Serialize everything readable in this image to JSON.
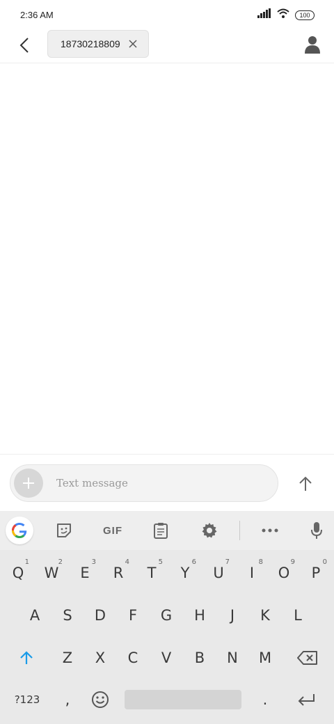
{
  "status_bar": {
    "time": "2:36 AM",
    "battery": "100"
  },
  "header": {
    "recipient": "18730218809"
  },
  "compose": {
    "placeholder": "Text message"
  },
  "keyboard": {
    "toolbar": {
      "gif_label": "GIF"
    },
    "row1": [
      {
        "label": "Q",
        "hint": "1"
      },
      {
        "label": "W",
        "hint": "2"
      },
      {
        "label": "E",
        "hint": "3"
      },
      {
        "label": "R",
        "hint": "4"
      },
      {
        "label": "T",
        "hint": "5"
      },
      {
        "label": "Y",
        "hint": "6"
      },
      {
        "label": "U",
        "hint": "7"
      },
      {
        "label": "I",
        "hint": "8"
      },
      {
        "label": "O",
        "hint": "9"
      },
      {
        "label": "P",
        "hint": "0"
      }
    ],
    "row2": [
      "A",
      "S",
      "D",
      "F",
      "G",
      "H",
      "J",
      "K",
      "L"
    ],
    "row3": [
      "Z",
      "X",
      "C",
      "V",
      "B",
      "N",
      "M"
    ],
    "row4": {
      "symbols": "?123",
      "comma": ",",
      "period": "."
    }
  },
  "colors": {
    "accent": "#1a9be8",
    "keyboard_bg": "#e9e9e9"
  }
}
